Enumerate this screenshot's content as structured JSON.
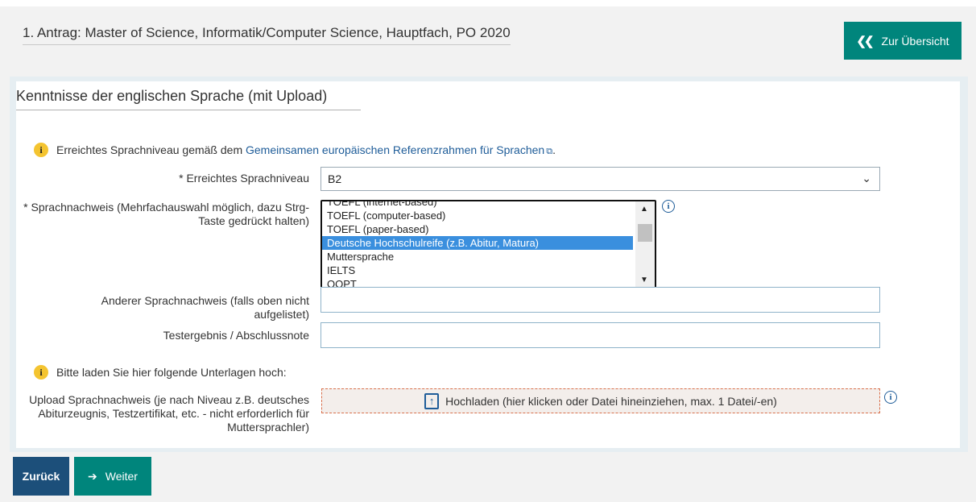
{
  "header": {
    "title": "1. Antrag: Master of Science, Informatik/Computer Science, Hauptfach, PO 2020",
    "overview_button": "Zur Übersicht"
  },
  "section": {
    "title": "Kenntnisse der englischen Sprache (mit Upload)",
    "info_text": "Erreichtes Sprachniveau gemäß dem",
    "info_link": "Gemeinsamen europäischen Referenzrahmen für Sprachen",
    "info_suffix": "."
  },
  "form": {
    "level_label": "* Erreichtes Sprachniveau",
    "level_value": "B2",
    "proof_label": "* Sprachnachweis (Mehrfachauswahl möglich, dazu Strg-Taste gedrückt halten)",
    "proof_options": [
      {
        "label": "TOEFL (internet-based)",
        "selected": false
      },
      {
        "label": "TOEFL (computer-based)",
        "selected": false
      },
      {
        "label": "TOEFL (paper-based)",
        "selected": false
      },
      {
        "label": "Deutsche Hochschulreife (z.B. Abitur, Matura)",
        "selected": true
      },
      {
        "label": "Muttersprache",
        "selected": false
      },
      {
        "label": "IELTS",
        "selected": false
      },
      {
        "label": "OOPT",
        "selected": false
      }
    ],
    "other_proof_label": "Anderer Sprachnachweis (falls oben nicht aufgelistet)",
    "other_proof_value": "",
    "test_result_label": "Testergebnis / Abschlussnote",
    "test_result_value": "",
    "upload_info": "Bitte laden Sie hier folgende Unterlagen hoch:",
    "upload_label": "Upload Sprachnachweis (je nach Niveau z.B. deutsches Abiturzeugnis, Testzertifikat, etc. - nicht erforderlich für Muttersprachler)",
    "upload_button": "Hochladen (hier klicken oder Datei hineinziehen, max. 1 Datei/-en)"
  },
  "footer": {
    "back_button": "Zurück",
    "next_button": "Weiter"
  },
  "colors": {
    "teal_accent": "#00857c",
    "navy_button": "#1c4f7a",
    "link_blue": "#1f5d99",
    "info_yellow": "#f4c430",
    "selected_option": "#3a8fde",
    "upload_border": "#d9704c"
  },
  "icons": [
    "chevrons-left-icon",
    "info-icon",
    "external-link-icon",
    "chevron-down-icon",
    "info-circle-icon",
    "upload-icon",
    "arrow-right-icon"
  ]
}
